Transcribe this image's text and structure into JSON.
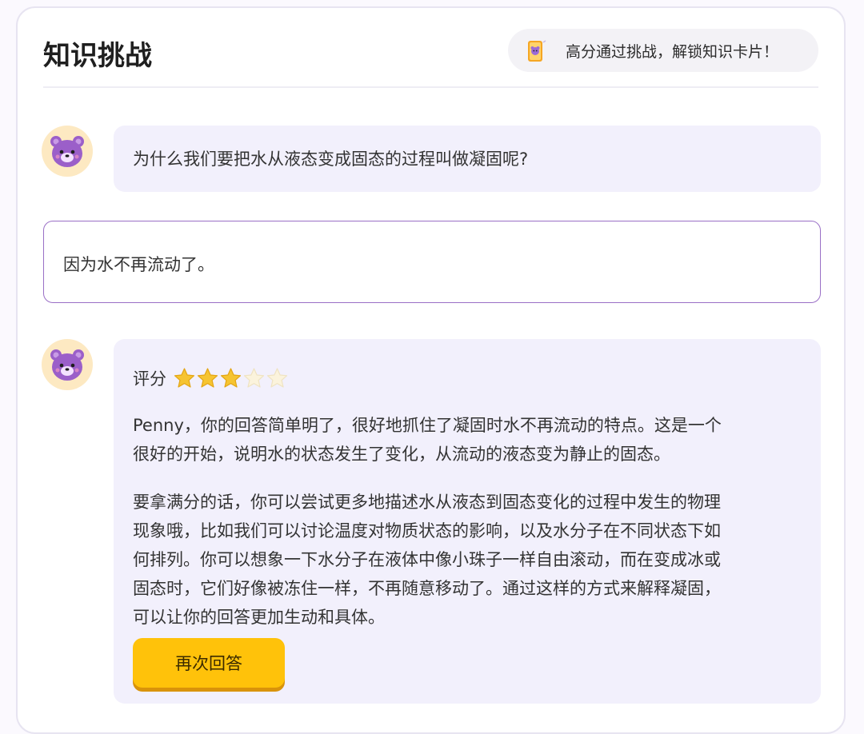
{
  "header": {
    "title": "知识挑战",
    "unlock_text": "高分通过挑战，解锁知识卡片！"
  },
  "question": {
    "text": "为什么我们要把水从液态变成固态的过程叫做凝固呢?"
  },
  "answer": {
    "value": "因为水不再流动了。"
  },
  "feedback": {
    "score_label": "评分",
    "score_stars": 3,
    "score_max": 5,
    "paragraph1_line1": "Penny，你的回答简单明了，很好地抓住了凝固时水不再流动的特点。这是一个",
    "paragraph1_line2": "很好的开始，说明水的状态发生了变化，从流动的液态变为静止的固态。",
    "paragraph2_line1": "要拿满分的话，你可以尝试更多地描述水从液态到固态变化的过程中发生的物理",
    "paragraph2_line2": "现象哦，比如我们可以讨论温度对物质状态的影响，以及水分子在不同状态下如",
    "paragraph2_line3": "何排列。你可以想象一下水分子在液体中像小珠子一样自由滚动，而在变成冰或",
    "paragraph2_line4": "固态时，它们好像被冻住一样，不再随意移动了。通过这样的方式来解释凝固，",
    "paragraph2_line5": "可以让你的回答更加生动和具体。",
    "retry_label": "再次回答"
  },
  "icons": {
    "avatar": "purple-bear-icon",
    "card": "knowledge-card-icon",
    "star": "star-icon"
  },
  "colors": {
    "accent_purple": "#9a6fc6",
    "bubble_bg": "#f2f0fc",
    "button_yellow": "#ffc20a",
    "star_gold": "#f6c431"
  }
}
